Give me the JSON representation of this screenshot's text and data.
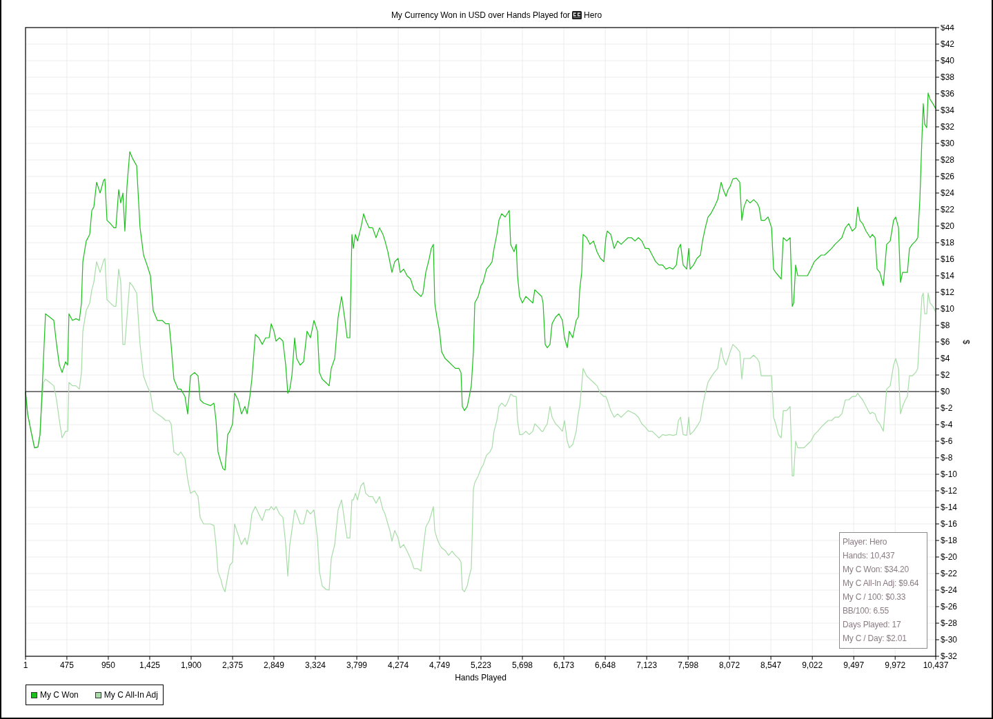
{
  "title": {
    "text": "My Currency Won in USD over Hands Played for",
    "player": "Hero"
  },
  "chart_data": {
    "type": "line",
    "grid": true,
    "xlabel": "Hands Played",
    "ylabel": "$",
    "xlim": [
      1,
      10437
    ],
    "ylim": [
      -32,
      44
    ],
    "x": [
      1,
      25,
      64,
      104,
      143,
      167,
      183,
      207,
      230,
      278,
      325,
      357,
      389,
      420,
      460,
      484,
      499,
      539,
      579,
      618,
      642,
      658,
      697,
      737,
      761,
      784,
      816,
      856,
      895,
      911,
      935,
      974,
      1014,
      1037,
      1069,
      1093,
      1117,
      1140,
      1164,
      1196,
      1227,
      1275,
      1314,
      1354,
      1394,
      1433,
      1465,
      1512,
      1568,
      1607,
      1647,
      1670,
      1702,
      1750,
      1781,
      1829,
      1860,
      1892,
      1939,
      1979,
      2003,
      2042,
      2121,
      2161,
      2185,
      2208,
      2240,
      2264,
      2288,
      2319,
      2343,
      2375,
      2398,
      2438,
      2477,
      2517,
      2541,
      2573,
      2596,
      2636,
      2675,
      2715,
      2754,
      2794,
      2818,
      2849,
      2873,
      2913,
      2952,
      2984,
      3008,
      3031,
      3055,
      3087,
      3110,
      3150,
      3189,
      3229,
      3268,
      3308,
      3348,
      3371,
      3403,
      3443,
      3482,
      3506,
      3546,
      3585,
      3625,
      3664,
      3688,
      3720,
      3743,
      3759,
      3783,
      3807,
      3846,
      3878,
      3901,
      3941,
      3980,
      4020,
      4060,
      4099,
      4123,
      4155,
      4178,
      4202,
      4234,
      4273,
      4297,
      4337,
      4376,
      4416,
      4455,
      4495,
      4535,
      4558,
      4590,
      4630,
      4653,
      4677,
      4693,
      4717,
      4748,
      4772,
      4812,
      4851,
      4891,
      4930,
      4970,
      4994,
      5009,
      5033,
      5065,
      5089,
      5112,
      5136,
      5152,
      5191,
      5223,
      5247,
      5286,
      5326,
      5350,
      5373,
      5405,
      5429,
      5460,
      5500,
      5524,
      5547,
      5563,
      5603,
      5627,
      5642,
      5666,
      5698,
      5737,
      5777,
      5817,
      5840,
      5880,
      5919,
      5935,
      5959,
      5983,
      6014,
      6038,
      6078,
      6117,
      6157,
      6180,
      6212,
      6236,
      6275,
      6315,
      6339,
      6355,
      6378,
      6394,
      6434,
      6473,
      6513,
      6553,
      6592,
      6632,
      6655,
      6671,
      6711,
      6750,
      6790,
      6830,
      6869,
      6909,
      6948,
      6988,
      7028,
      7067,
      7107,
      7146,
      7186,
      7226,
      7265,
      7305,
      7344,
      7384,
      7424,
      7463,
      7487,
      7511,
      7541,
      7582,
      7605,
      7621,
      7660,
      7700,
      7739,
      7763,
      7795,
      7826,
      7858,
      7898,
      7937,
      7977,
      8001,
      8032,
      8056,
      8080,
      8111,
      8151,
      8190,
      8214,
      8238,
      8270,
      8309,
      8349,
      8388,
      8412,
      8436,
      8476,
      8515,
      8555,
      8578,
      8602,
      8634,
      8665,
      8689,
      8728,
      8768,
      8792,
      8808,
      8831,
      8855,
      8887,
      8926,
      8966,
      9005,
      9045,
      9084,
      9124,
      9163,
      9203,
      9243,
      9282,
      9322,
      9361,
      9401,
      9440,
      9480,
      9519,
      9543,
      9567,
      9599,
      9638,
      9662,
      9686,
      9709,
      9741,
      9765,
      9796,
      9836,
      9875,
      9915,
      9954,
      9978,
      10010,
      10033,
      10057,
      10089,
      10112,
      10136,
      10168,
      10207,
      10231,
      10255,
      10279,
      10294,
      10310,
      10334,
      10350,
      10373,
      10405,
      10437
    ],
    "series": [
      {
        "name": "My C Won",
        "color": "#1cbf1c",
        "values": [
          0,
          -2.7,
          -4.8,
          -6.8,
          -6.7,
          -5.2,
          -1.8,
          4,
          9.4,
          9,
          8.6,
          5.7,
          3.2,
          2.3,
          3.6,
          3.2,
          9.4,
          8.6,
          8.8,
          8.6,
          10.7,
          15.7,
          18.2,
          19,
          21.9,
          22.3,
          25.3,
          24,
          25.5,
          25.7,
          20.7,
          20.3,
          19.8,
          19.8,
          24.4,
          22.8,
          24,
          19.4,
          24.8,
          29,
          28.2,
          27.3,
          19.8,
          16.5,
          15.3,
          14,
          9.8,
          8.6,
          8.6,
          8.2,
          8.2,
          5.7,
          1.5,
          0.3,
          0.3,
          -0.6,
          -2.7,
          1.9,
          2.3,
          1.9,
          -1,
          -1.4,
          -1.7,
          -1.4,
          -3.5,
          -7.3,
          -8.5,
          -9.3,
          -9.5,
          -5.2,
          -4.8,
          -3.9,
          -0.2,
          -1,
          -2.7,
          -1.8,
          -2.7,
          -0.6,
          1.5,
          6.9,
          6.5,
          5.7,
          6.5,
          6.5,
          8.2,
          7.3,
          6.1,
          6.5,
          6.1,
          3.2,
          -0.2,
          0.3,
          1.9,
          6.5,
          4,
          3.2,
          3.6,
          7.3,
          6.5,
          8.6,
          7.3,
          2.3,
          1.5,
          1.1,
          0.7,
          2.8,
          4,
          9,
          11.5,
          8.6,
          6.5,
          6.5,
          19,
          17.3,
          19,
          18.2,
          19.8,
          21.5,
          20.7,
          19.8,
          19.8,
          18.6,
          19.8,
          19,
          18.2,
          16.9,
          15.7,
          14.4,
          15.7,
          16.1,
          14.4,
          14.8,
          14,
          13.6,
          12.3,
          11.9,
          11.5,
          11.9,
          14.4,
          16.1,
          17.3,
          17.8,
          10.7,
          9,
          7.3,
          4.8,
          4,
          3.6,
          3.2,
          2.8,
          2.8,
          2.3,
          -1.8,
          -2.3,
          -1.8,
          -0.6,
          0.7,
          4.8,
          10.7,
          11.5,
          12.8,
          13.2,
          14.8,
          15.3,
          15.7,
          17.3,
          19,
          20.7,
          21.5,
          21.1,
          21.5,
          21.9,
          17.8,
          16.9,
          17.8,
          14,
          11.5,
          10.7,
          11.5,
          11.1,
          10.7,
          12.3,
          11.9,
          11.5,
          10.7,
          5.7,
          5.3,
          5.7,
          8.2,
          9,
          9.4,
          8.6,
          6.5,
          5.3,
          7.3,
          6.5,
          8.6,
          9,
          12.3,
          14.4,
          19,
          18.6,
          17.8,
          18.2,
          16.9,
          16.1,
          15.7,
          18.6,
          19.4,
          19,
          17.3,
          18.2,
          17.8,
          18.2,
          18.6,
          18.6,
          18.2,
          18.6,
          18.2,
          17.3,
          17.3,
          16.5,
          15.7,
          15.3,
          15.3,
          14.8,
          15,
          14.8,
          15.3,
          17.3,
          17.8,
          15.3,
          14.8,
          17.3,
          14.8,
          15.3,
          16.1,
          16.5,
          18.2,
          19.8,
          21.1,
          21.5,
          22.3,
          23.2,
          25.3,
          24.4,
          23.6,
          24.4,
          24.8,
          25.7,
          25.8,
          25.3,
          20.7,
          22.3,
          23.2,
          22.8,
          23.2,
          22.8,
          22.3,
          20.7,
          20.7,
          21.1,
          19.8,
          14.8,
          14.4,
          14,
          13.6,
          18.6,
          18.2,
          18.6,
          10.3,
          10.7,
          15.3,
          14,
          14,
          14,
          14,
          14.8,
          15.7,
          16.1,
          16.5,
          16.5,
          16.9,
          17.3,
          17.8,
          18.2,
          18.6,
          19.8,
          20.3,
          19.4,
          19.8,
          22.3,
          20.7,
          20.3,
          19.4,
          19,
          18.6,
          19,
          18.6,
          14.8,
          14.4,
          12.8,
          17.8,
          18.2,
          20.7,
          21.1,
          19.8,
          13.2,
          14.4,
          14.4,
          14.4,
          17.3,
          17.8,
          18.2,
          18.6,
          23.2,
          30.7,
          34.8,
          32.3,
          31.9,
          36.1,
          35.3,
          34.8,
          34.2
        ]
      },
      {
        "name": "My C All-In Adj",
        "color": "#a6dca6",
        "values": [
          0,
          -2.7,
          -4.8,
          -6.8,
          -6.7,
          -5.2,
          -1.8,
          1.1,
          1.5,
          1.1,
          0.7,
          -1,
          -3.5,
          -5.6,
          -4.8,
          -4.8,
          1.1,
          0.7,
          0.7,
          0.3,
          2.3,
          7.3,
          9.8,
          10.7,
          12.3,
          13.2,
          15.7,
          14.4,
          15.8,
          16.1,
          11.1,
          10.7,
          10.3,
          10.3,
          14.8,
          13.2,
          5.7,
          5.7,
          9,
          13.2,
          12.8,
          11.9,
          5.7,
          1.9,
          0.7,
          -0.2,
          -2.3,
          -2.7,
          -3.1,
          -3.5,
          -3.5,
          -3.9,
          -7.3,
          -7.7,
          -7.3,
          -8.1,
          -10.6,
          -12.3,
          -12,
          -12.7,
          -15.2,
          -16,
          -16,
          -16.2,
          -18.5,
          -21.8,
          -22.7,
          -23.7,
          -24.2,
          -22.3,
          -21,
          -20.6,
          -16,
          -17.3,
          -18.5,
          -17.7,
          -18.5,
          -16.8,
          -14.8,
          -13.9,
          -14.8,
          -15.6,
          -14.3,
          -14.3,
          -13.9,
          -14.3,
          -13.9,
          -14.8,
          -15.2,
          -18.5,
          -22.3,
          -18.5,
          -16.8,
          -14.3,
          -14.8,
          -16,
          -16,
          -14.3,
          -14.8,
          -14.3,
          -17.7,
          -21.8,
          -23.5,
          -23.9,
          -24,
          -20.2,
          -18.5,
          -14.3,
          -13.1,
          -16,
          -17.7,
          -17.7,
          -13.1,
          -13.1,
          -12.3,
          -13.1,
          -11.4,
          -11,
          -12.3,
          -12.7,
          -12.7,
          -13.5,
          -12.7,
          -14.3,
          -14.8,
          -16,
          -16.8,
          -18.1,
          -16.8,
          -17.7,
          -18.9,
          -18.5,
          -19.3,
          -20.2,
          -21.4,
          -21.4,
          -21.7,
          -19.3,
          -16.4,
          -15.6,
          -14.8,
          -13.9,
          -16.8,
          -17.7,
          -18.5,
          -18.9,
          -19.2,
          -19.8,
          -19.3,
          -19.8,
          -20.2,
          -20.6,
          -23.9,
          -24.2,
          -23.5,
          -22.3,
          -21.4,
          -11.8,
          -11,
          -10.2,
          -9.3,
          -8.9,
          -7.7,
          -7.3,
          -6.8,
          -4.8,
          -3.5,
          -1.8,
          -1.4,
          -1.8,
          -1.4,
          -0.8,
          -0.3,
          -0.6,
          -0.6,
          -3.5,
          -5.2,
          -5.2,
          -4.8,
          -5.2,
          -4.8,
          -3.9,
          -4.3,
          -4.8,
          -4.8,
          -4.3,
          -3.9,
          -1.8,
          -3.1,
          -3.9,
          -4.3,
          -4.8,
          -3.5,
          -6,
          -6.8,
          -6.4,
          -4.8,
          -2.7,
          -1.8,
          0.7,
          2.8,
          1.9,
          1.5,
          1.1,
          0.7,
          -0.2,
          -0.6,
          -0.6,
          -1,
          -2.3,
          -3.1,
          -2.7,
          -3.1,
          -2.7,
          -2.3,
          -2.5,
          -2.7,
          -3.1,
          -3.9,
          -4.3,
          -4.8,
          -4.8,
          -5.2,
          -5.6,
          -5.2,
          -5.3,
          -5.2,
          -5.3,
          -5.2,
          -3.5,
          -3.1,
          -5.2,
          -5.3,
          -3.1,
          -5.2,
          -4.8,
          -4.2,
          -3.5,
          -1.8,
          -0.2,
          1.1,
          1.7,
          2.3,
          2.8,
          5.3,
          4,
          3.2,
          4,
          4.8,
          5.7,
          5.3,
          4.8,
          1.5,
          4,
          4,
          4,
          4.4,
          4,
          3.6,
          1.9,
          1.9,
          1.9,
          1.9,
          -3.1,
          -3.9,
          -5.2,
          -5.6,
          -2.3,
          -2.3,
          -1.8,
          -10.2,
          -10.2,
          -6,
          -6.8,
          -6.8,
          -6.8,
          -6.4,
          -6,
          -5.2,
          -4.8,
          -4.3,
          -3.9,
          -3.5,
          -3.5,
          -3.1,
          -3.1,
          -2.7,
          -1,
          -1,
          -0.6,
          -0.6,
          -0.2,
          -0.6,
          -1,
          -1.8,
          -2.3,
          -2.7,
          -2.5,
          -2.7,
          -3.5,
          -3.9,
          -4.8,
          0.3,
          0.7,
          3.2,
          4,
          2.8,
          -2.7,
          -1.8,
          -1,
          -0.6,
          1.9,
          1.9,
          2.3,
          2.8,
          7.3,
          11.5,
          11.9,
          9.4,
          9.4,
          11.9,
          10.7,
          10.3,
          9.6
        ]
      }
    ],
    "xticks": [
      {
        "value": 1,
        "label": "1"
      },
      {
        "value": 475,
        "label": "475"
      },
      {
        "value": 950,
        "label": "950"
      },
      {
        "value": 1425,
        "label": "1,425"
      },
      {
        "value": 1900,
        "label": "1,900"
      },
      {
        "value": 2375,
        "label": "2,375"
      },
      {
        "value": 2849,
        "label": "2,849"
      },
      {
        "value": 3324,
        "label": "3,324"
      },
      {
        "value": 3799,
        "label": "3,799"
      },
      {
        "value": 4274,
        "label": "4,274"
      },
      {
        "value": 4749,
        "label": "4,749"
      },
      {
        "value": 5223,
        "label": "5,223"
      },
      {
        "value": 5698,
        "label": "5,698"
      },
      {
        "value": 6173,
        "label": "6,173"
      },
      {
        "value": 6648,
        "label": "6,648"
      },
      {
        "value": 7123,
        "label": "7,123"
      },
      {
        "value": 7598,
        "label": "7,598"
      },
      {
        "value": 8072,
        "label": "8,072"
      },
      {
        "value": 8547,
        "label": "8,547"
      },
      {
        "value": 9022,
        "label": "9,022"
      },
      {
        "value": 9497,
        "label": "9,497"
      },
      {
        "value": 9972,
        "label": "9,972"
      },
      {
        "value": 10437,
        "label": "10,437"
      }
    ],
    "yticks": [
      {
        "value": -32,
        "label": "$-32"
      },
      {
        "value": -30,
        "label": "$-30"
      },
      {
        "value": -28,
        "label": "$-28"
      },
      {
        "value": -26,
        "label": "$-26"
      },
      {
        "value": -24,
        "label": "$-24"
      },
      {
        "value": -22,
        "label": "$-22"
      },
      {
        "value": -20,
        "label": "$-20"
      },
      {
        "value": -18,
        "label": "$-18"
      },
      {
        "value": -16,
        "label": "$-16"
      },
      {
        "value": -14,
        "label": "$-14"
      },
      {
        "value": -12,
        "label": "$-12"
      },
      {
        "value": -10,
        "label": "$-10"
      },
      {
        "value": -8,
        "label": "$-8"
      },
      {
        "value": -6,
        "label": "$-6"
      },
      {
        "value": -4,
        "label": "$-4"
      },
      {
        "value": -2,
        "label": "$-2"
      },
      {
        "value": 0,
        "label": "$0"
      },
      {
        "value": 2,
        "label": "$2"
      },
      {
        "value": 4,
        "label": "$4"
      },
      {
        "value": 6,
        "label": "$6"
      },
      {
        "value": 8,
        "label": "$8"
      },
      {
        "value": 10,
        "label": "$10"
      },
      {
        "value": 12,
        "label": "$12"
      },
      {
        "value": 14,
        "label": "$14"
      },
      {
        "value": 16,
        "label": "$16"
      },
      {
        "value": 18,
        "label": "$18"
      },
      {
        "value": 20,
        "label": "$20"
      },
      {
        "value": 22,
        "label": "$22"
      },
      {
        "value": 24,
        "label": "$24"
      },
      {
        "value": 26,
        "label": "$26"
      },
      {
        "value": 28,
        "label": "$28"
      },
      {
        "value": 30,
        "label": "$30"
      },
      {
        "value": 32,
        "label": "$32"
      },
      {
        "value": 34,
        "label": "$34"
      },
      {
        "value": 36,
        "label": "$36"
      },
      {
        "value": 38,
        "label": "$38"
      },
      {
        "value": 40,
        "label": "$40"
      },
      {
        "value": 42,
        "label": "$42"
      },
      {
        "value": 44,
        "label": "$44"
      }
    ]
  },
  "stats": [
    "Player: Hero",
    "Hands: 10,437",
    "My C Won: $34.20",
    "My C All-In Adj: $9.64",
    "My C / 100: $0.33",
    "BB/100: 6.55",
    "Days Played: 17",
    "My C / Day: $2.01"
  ]
}
